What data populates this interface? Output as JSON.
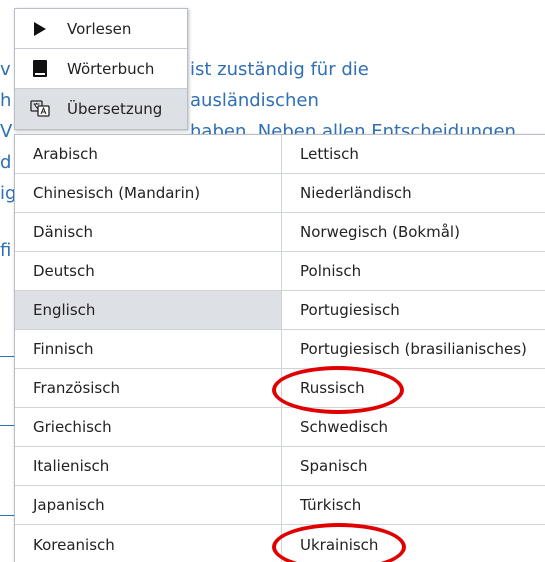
{
  "background": {
    "lines": [
      "v",
      "h",
      "V",
      "d",
      "ig",
      "fi"
    ],
    "right_fragments": [
      "ist zuständig für die",
      "ausländischen",
      "haben. Neben allen Entscheidungen"
    ]
  },
  "context_menu": {
    "items": [
      {
        "label": "Vorlesen",
        "icon": "play-icon"
      },
      {
        "label": "Wörterbuch",
        "icon": "book-icon"
      },
      {
        "label": "Übersetzung",
        "icon": "translate-icon"
      }
    ]
  },
  "languages": {
    "left": [
      "Arabisch",
      "Chinesisch (Mandarin)",
      "Dänisch",
      "Deutsch",
      "Englisch",
      "Finnisch",
      "Französisch",
      "Griechisch",
      "Italienisch",
      "Japanisch",
      "Koreanisch"
    ],
    "right": [
      "Lettisch",
      "Niederländisch",
      "Norwegisch (Bokmål)",
      "Polnisch",
      "Portugiesisch",
      "Portugiesisch (brasilianisches)",
      "Russisch",
      "Schwedisch",
      "Spanisch",
      "Türkisch",
      "Ukrainisch"
    ],
    "highlighted": "Englisch",
    "circled": [
      "Russisch",
      "Ukrainisch"
    ]
  },
  "colors": {
    "link_text": "#2f6fb4",
    "highlight_bg": "#dde1e6",
    "annotation_red": "#e00000"
  }
}
